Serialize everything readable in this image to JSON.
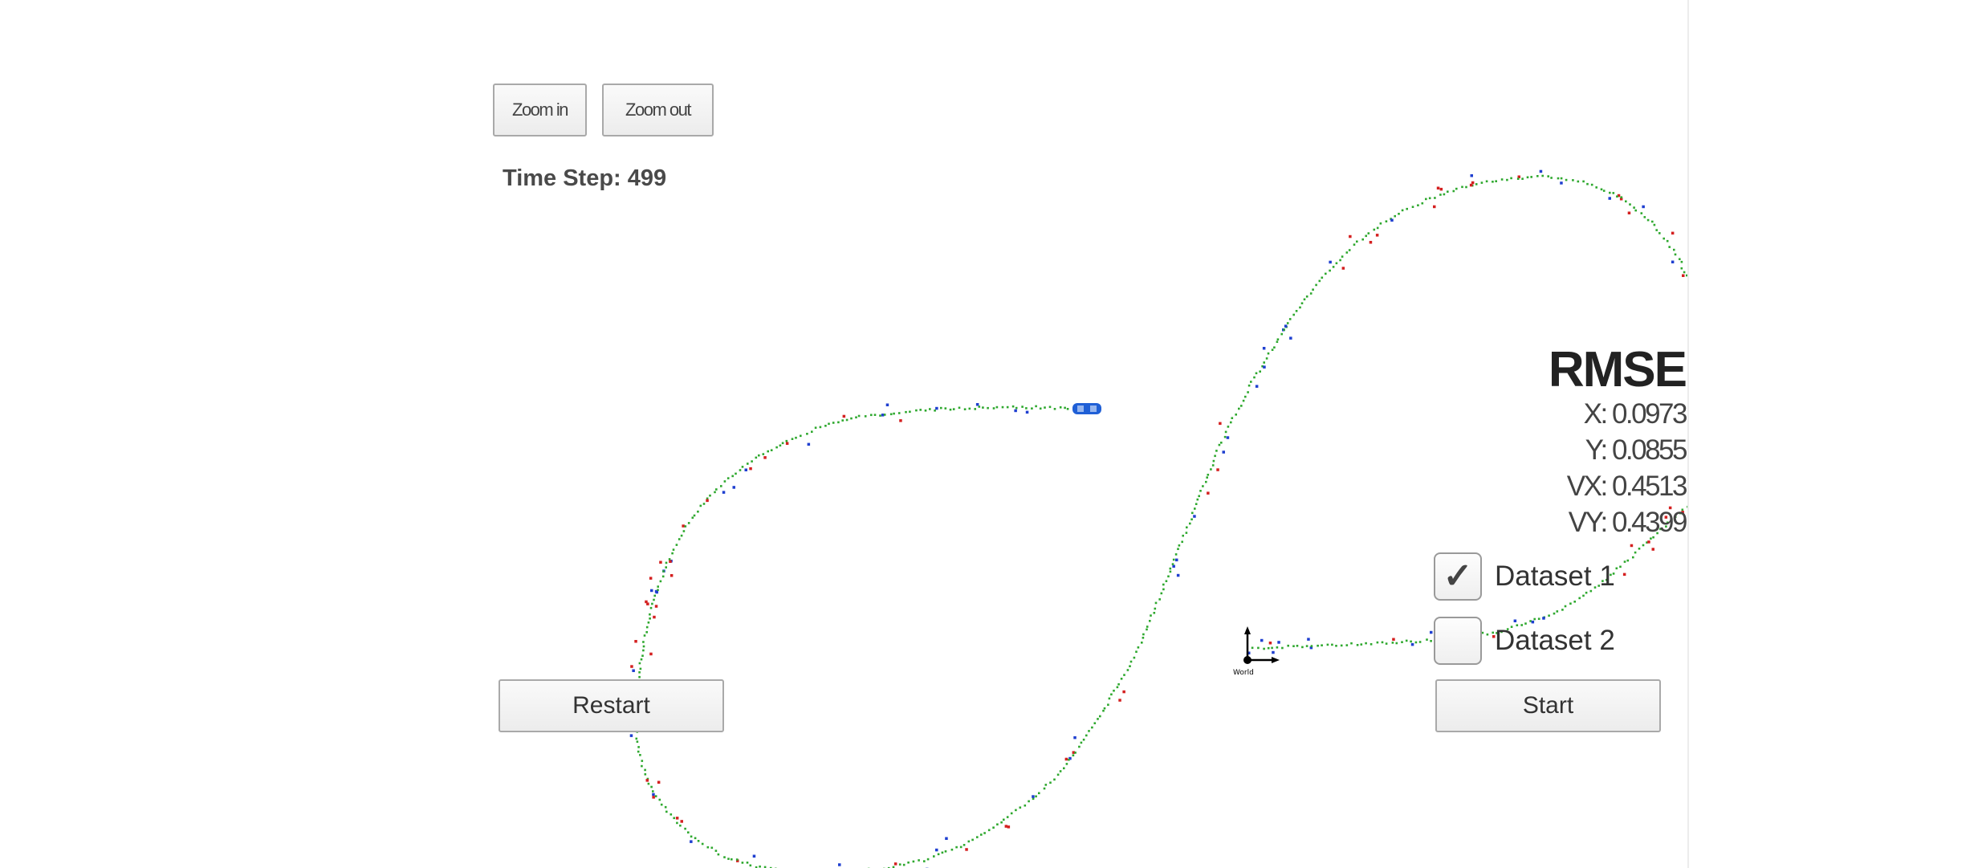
{
  "controls": {
    "zoom_in_label": "Zoom in",
    "zoom_out_label": "Zoom out",
    "restart_label": "Restart",
    "start_label": "Start"
  },
  "status": {
    "time_step_label": "Time Step:",
    "time_step_value": "499"
  },
  "rmse": {
    "title": "RMSE",
    "rows": [
      {
        "label": "X:",
        "value": "0.0973"
      },
      {
        "label": "Y:",
        "value": "0.0855"
      },
      {
        "label": "VX:",
        "value": "0.4513"
      },
      {
        "label": "VY:",
        "value": "0.4399"
      }
    ]
  },
  "datasets": [
    {
      "label": "Dataset 1",
      "checked": true
    },
    {
      "label": "Dataset 2",
      "checked": false
    }
  ],
  "colors": {
    "estimate": "#2ea82e",
    "lidar": "#d42020",
    "radar": "#1f3fd0",
    "car": "#1f5fd6"
  },
  "icons": {
    "car": "car-icon",
    "origin_axes": "axes-origin-icon",
    "checkmark": "checkmark-icon"
  }
}
